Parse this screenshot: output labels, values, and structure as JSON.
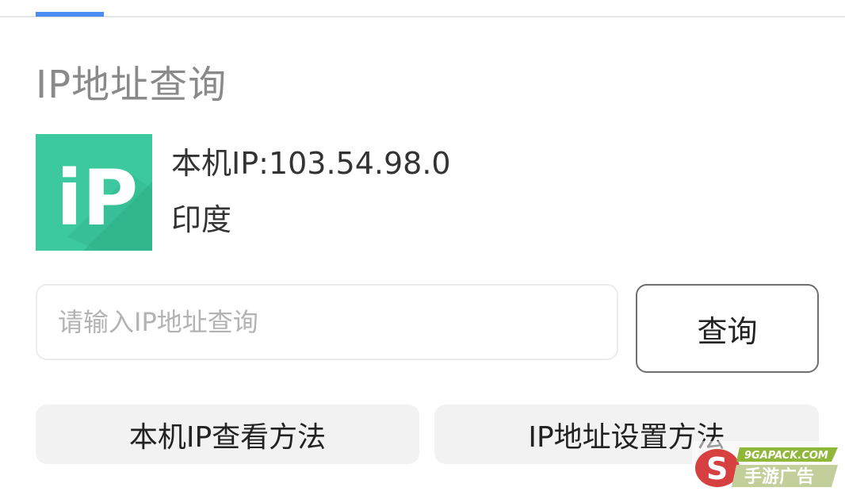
{
  "header": {
    "active_tab_indicator_color": "#4a8cf0"
  },
  "page": {
    "title": "IP地址查询"
  },
  "logo": {
    "text": "iP",
    "colors": {
      "primary": "#3cc9a0",
      "shadow": "#2fae86"
    }
  },
  "my_ip": {
    "label": "本机IP:",
    "value": "103.54.98.0",
    "location": "印度"
  },
  "search": {
    "placeholder": "请输入IP地址查询",
    "value": "",
    "button_label": "查询"
  },
  "links": {
    "left_label": "本机IP查看方法",
    "right_label": "IP地址设置方法"
  },
  "watermark": {
    "text_top": "9GAPACK.COM",
    "text_bottom": "手游广告"
  }
}
